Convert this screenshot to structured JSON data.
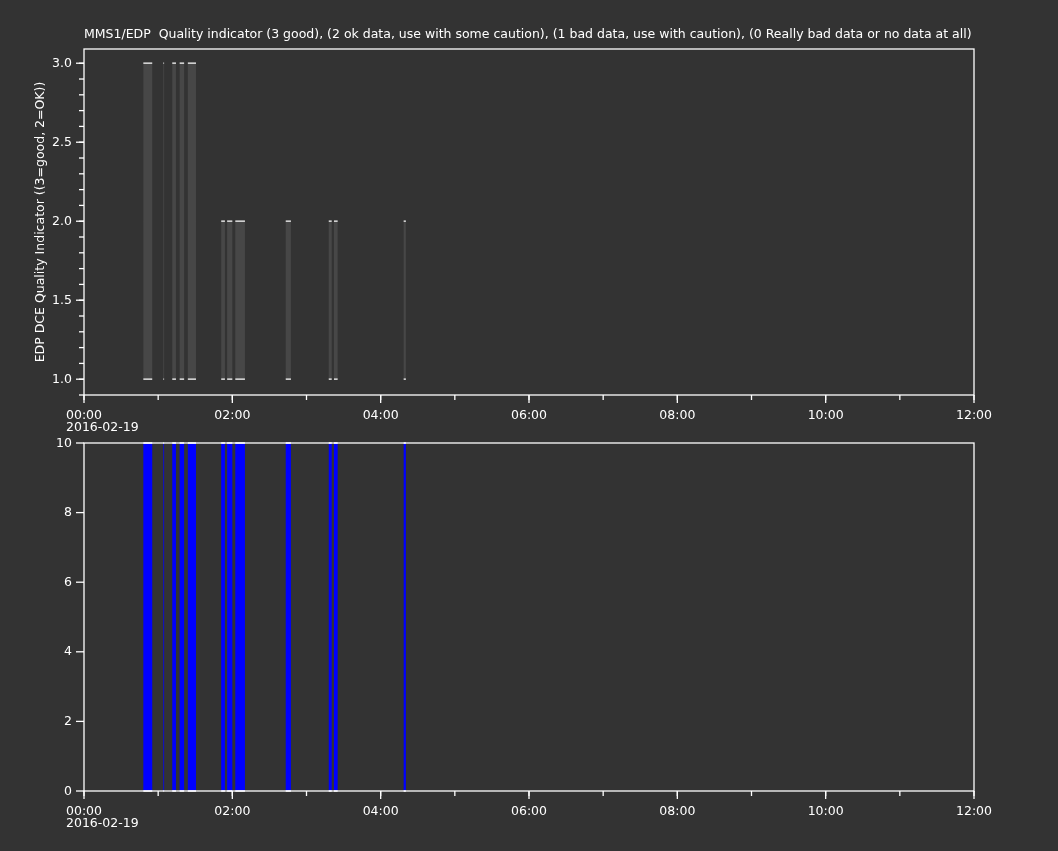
{
  "charts": [
    {
      "chart_data": {
        "type": "area",
        "title": "MMS1/EDP  Quality indicator (3 good), (2 ok data, use with some caution), (1 bad data, use with caution), (0 Really bad data or no data at all)",
        "ylabel": "EDP DCE Quality Indicator ((3=good, 2=OK))",
        "xlim": [
          0,
          12
        ],
        "ylim": [
          0.9,
          3.09
        ],
        "xticks": [
          {
            "value": 0,
            "label": "00:00"
          },
          {
            "value": 2,
            "label": "02:00"
          },
          {
            "value": 4,
            "label": "04:00"
          },
          {
            "value": 6,
            "label": "06:00"
          },
          {
            "value": 8,
            "label": "08:00"
          },
          {
            "value": 10,
            "label": "10:00"
          },
          {
            "value": 12,
            "label": "12:00"
          }
        ],
        "yticks": [
          {
            "value": 1,
            "label": "1.0"
          },
          {
            "value": 1.5,
            "label": "1.5"
          },
          {
            "value": 2,
            "label": "2.0"
          },
          {
            "value": 2.5,
            "label": "2.5"
          },
          {
            "value": 3,
            "label": "3.0"
          }
        ],
        "x": [
          0.8,
          0.8,
          0.92,
          0.92,
          1.07,
          1.07,
          1.08,
          1.08,
          1.19,
          1.19,
          1.24,
          1.24,
          1.29,
          1.29,
          1.35,
          1.35,
          1.4,
          1.4,
          1.51,
          1.51,
          1.85,
          1.85,
          1.9,
          1.9,
          1.93,
          1.93,
          2.0,
          2.0,
          2.04,
          2.04,
          2.17,
          2.17,
          2.72,
          2.72,
          2.79,
          2.79,
          3.3,
          3.3,
          3.34,
          3.34,
          3.37,
          3.37,
          3.42,
          3.42,
          4.31,
          4.31,
          4.34,
          4.34
        ],
        "series": [
          {
            "color": "#474747",
            "values": [
              1,
              3,
              3,
              1,
              1,
              3,
              3,
              1,
              1,
              3,
              3,
              1,
              1,
              3,
              3,
              1,
              1,
              3,
              3,
              1,
              1,
              2,
              2,
              1,
              1,
              2,
              2,
              1,
              1,
              2,
              2,
              1,
              1,
              2,
              2,
              1,
              1,
              2,
              2,
              1,
              1,
              2,
              2,
              1,
              1,
              2,
              2,
              1
            ]
          }
        ]
      },
      "date_label": "2016-02-19"
    },
    {
      "chart_data": {
        "type": "area",
        "xlim": [
          0,
          12
        ],
        "ylim": [
          0,
          10
        ],
        "xticks": [
          {
            "value": 0,
            "label": "00:00"
          },
          {
            "value": 2,
            "label": "02:00"
          },
          {
            "value": 4,
            "label": "04:00"
          },
          {
            "value": 6,
            "label": "06:00"
          },
          {
            "value": 8,
            "label": "08:00"
          },
          {
            "value": 10,
            "label": "10:00"
          },
          {
            "value": 12,
            "label": "12:00"
          }
        ],
        "yticks": [
          {
            "value": 0,
            "label": "0"
          },
          {
            "value": 2,
            "label": "2"
          },
          {
            "value": 4,
            "label": "4"
          },
          {
            "value": 6,
            "label": "6"
          },
          {
            "value": 8,
            "label": "8"
          },
          {
            "value": 10,
            "label": "10"
          }
        ],
        "x": [
          0.8,
          0.8,
          0.92,
          0.92,
          1.07,
          1.07,
          1.08,
          1.08,
          1.19,
          1.19,
          1.24,
          1.24,
          1.29,
          1.29,
          1.35,
          1.35,
          1.4,
          1.4,
          1.51,
          1.51,
          1.85,
          1.85,
          1.9,
          1.9,
          1.93,
          1.93,
          2.0,
          2.0,
          2.04,
          2.04,
          2.17,
          2.17,
          2.72,
          2.72,
          2.79,
          2.79,
          3.3,
          3.3,
          3.34,
          3.34,
          3.37,
          3.37,
          3.42,
          3.42,
          4.31,
          4.31,
          4.34,
          4.34
        ],
        "series": [
          {
            "color": "#0000ff",
            "values": [
              0,
              10,
              10,
              0,
              0,
              10,
              10,
              0,
              0,
              10,
              10,
              0,
              0,
              10,
              10,
              0,
              0,
              10,
              10,
              0,
              0,
              10,
              10,
              0,
              0,
              10,
              10,
              0,
              0,
              10,
              10,
              0,
              0,
              10,
              10,
              0,
              0,
              10,
              10,
              0,
              0,
              10,
              10,
              0,
              0,
              10,
              10,
              0
            ]
          }
        ]
      },
      "date_label": "2016-02-19"
    }
  ]
}
